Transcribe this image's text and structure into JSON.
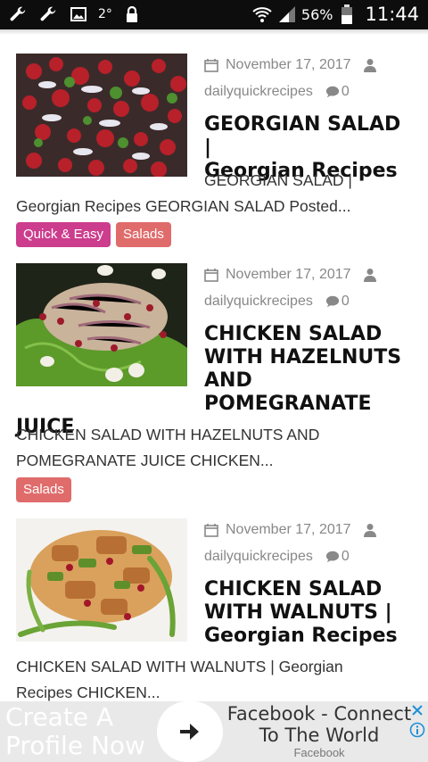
{
  "status_bar": {
    "temperature": "2°",
    "battery_percent": "56%",
    "time": "11:44"
  },
  "posts": [
    {
      "date": "November 17, 2017",
      "author": "dailyquickrecipes",
      "comments": "0",
      "title_lines": [
        "GEORGIAN SALAD |",
        "Georgian Recipes"
      ],
      "excerpt_lines": [
        "GEORGIAN SALAD |",
        "Georgian Recipes GEORGIAN SALAD Posted..."
      ],
      "tags": [
        "Quick & Easy",
        "Salads"
      ]
    },
    {
      "date": "November 17, 2017",
      "author": "dailyquickrecipes",
      "comments": "0",
      "title_lines": [
        "CHICKEN SALAD",
        "WITH HAZELNUTS",
        "AND POMEGRANATE",
        "JUICE"
      ],
      "excerpt_lines": [
        "CHICKEN SALAD WITH HAZELNUTS AND",
        "POMEGRANATE JUICE CHICKEN..."
      ],
      "tags": [
        "Salads"
      ]
    },
    {
      "date": "November 17, 2017",
      "author": "dailyquickrecipes",
      "comments": "0",
      "title_lines": [
        "CHICKEN SALAD",
        "WITH WALNUTS |",
        "Georgian Recipes"
      ],
      "excerpt_lines": [
        "CHICKEN SALAD WITH WALNUTS | Georgian",
        "Recipes CHICKEN..."
      ],
      "tags": []
    }
  ],
  "ad": {
    "left_lines": [
      "Create A",
      "Profile Now"
    ],
    "title_lines": [
      "Facebook - Connect",
      "To The World"
    ],
    "subtitle": "Facebook"
  },
  "colors": {
    "tag_quick_easy": "#cc3d8d",
    "tag_salads": "#e06b6b",
    "status_bar": "#0d0d0d"
  },
  "icons": [
    "wrench-icon",
    "image-icon",
    "lock-icon",
    "wifi-icon",
    "signal-icon",
    "battery-icon",
    "calendar-icon",
    "user-icon",
    "comment-icon",
    "arrow-right-icon",
    "close-icon",
    "info-icon"
  ]
}
